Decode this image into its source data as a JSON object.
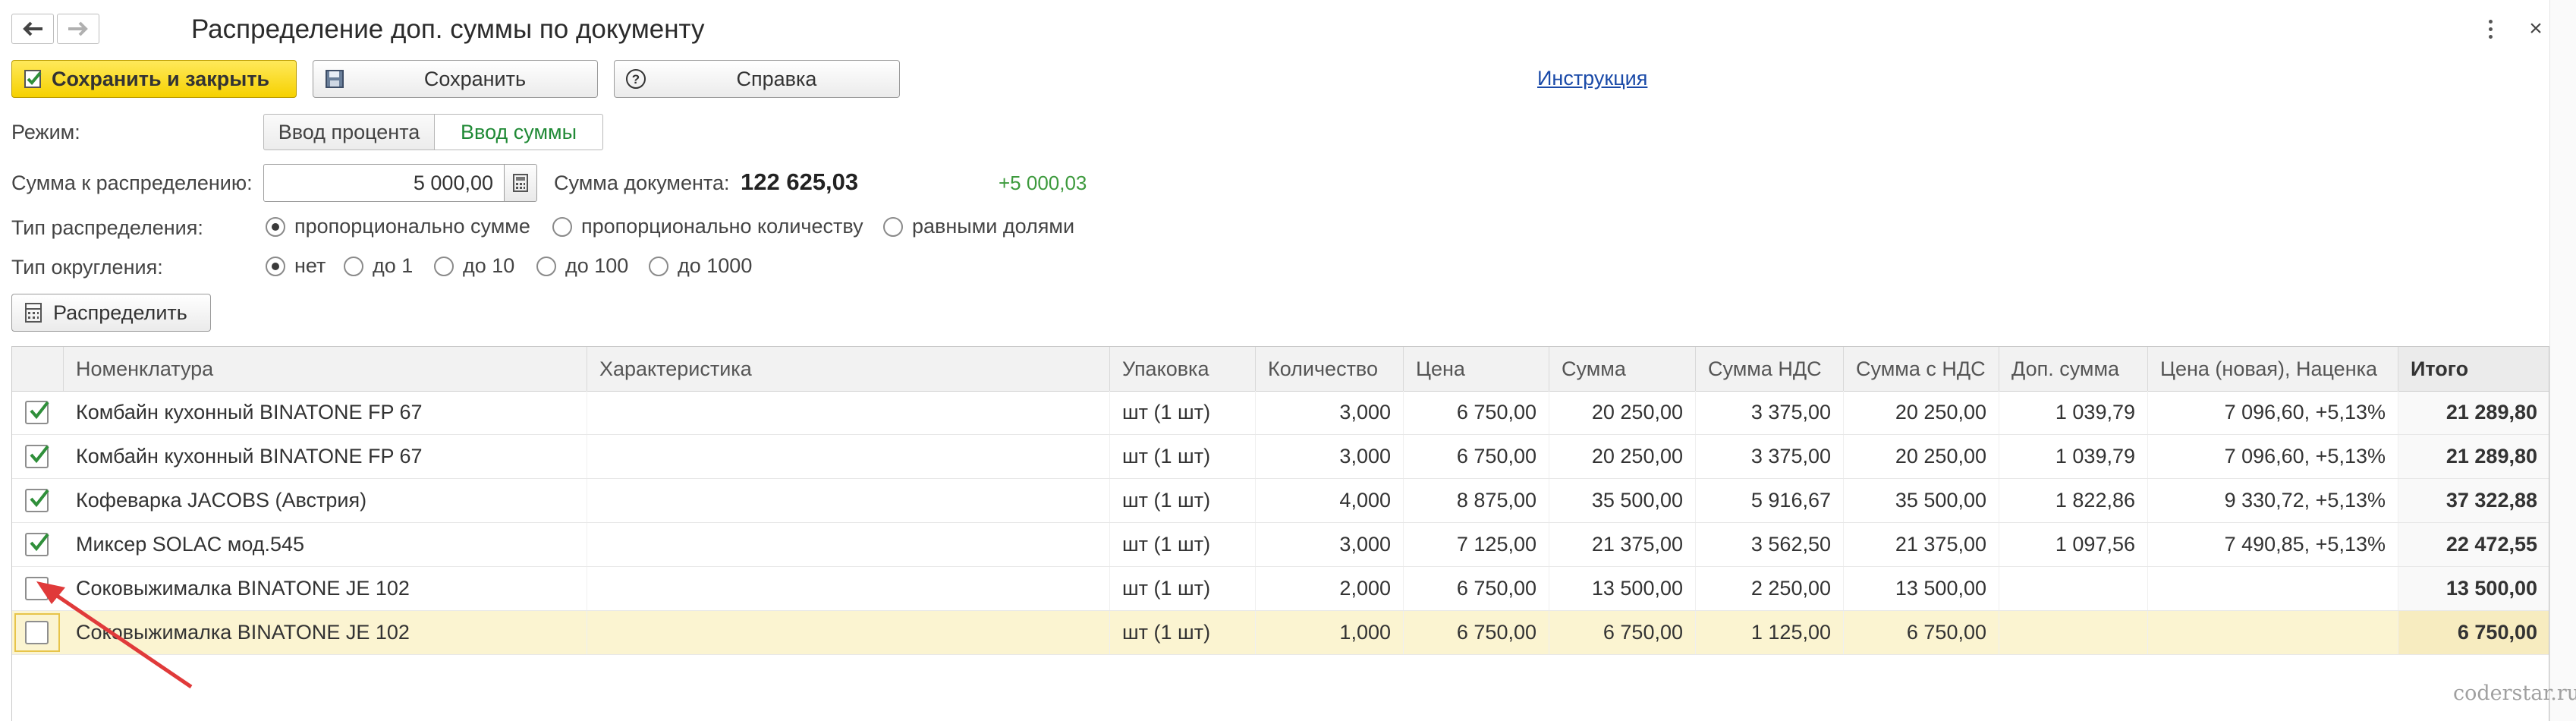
{
  "window": {
    "title": "Распределение доп. суммы по документу"
  },
  "toolbar": {
    "save_close": "Сохранить и закрыть",
    "save": "Сохранить",
    "help": "Справка",
    "instruction_link": "Инструкция"
  },
  "form": {
    "mode_label": "Режим:",
    "mode_options": [
      "Ввод процента",
      "Ввод суммы"
    ],
    "mode_selected": "Ввод суммы",
    "amount_label": "Сумма к распределению:",
    "amount_value": "5 000,00",
    "doc_sum_label": "Сумма документа:",
    "doc_sum_value": "122 625,03",
    "doc_sum_delta": "+5 000,03",
    "dist_type_label": "Тип распределения:",
    "dist_type_options": [
      "пропорционально сумме",
      "пропорционально количеству",
      "равными долями"
    ],
    "dist_type_selected": "пропорционально сумме",
    "rounding_label": "Тип округления:",
    "rounding_options": [
      "нет",
      "до 1",
      "до 10",
      "до 100",
      "до 1000"
    ],
    "rounding_selected": "нет",
    "distribute_button": "Распределить"
  },
  "table": {
    "columns": [
      "",
      "Номенклатура",
      "Характеристика",
      "Упаковка",
      "Количество",
      "Цена",
      "Сумма",
      "Сумма НДС",
      "Сумма с НДС",
      "Доп. сумма",
      "Цена (новая), Наценка",
      "Итого"
    ],
    "rows": [
      {
        "checked": true,
        "name": "Комбайн кухонный BINATONE FP 67",
        "char": "",
        "pack": "шт (1 шт)",
        "qty": "3,000",
        "price": "6 750,00",
        "sum": "20 250,00",
        "vat": "3 375,00",
        "sum_vat": "20 250,00",
        "extra": "1 039,79",
        "new_price": "7 096,60, +5,13%",
        "total": "21 289,80"
      },
      {
        "checked": true,
        "name": "Комбайн кухонный BINATONE FP 67",
        "char": "",
        "pack": "шт (1 шт)",
        "qty": "3,000",
        "price": "6 750,00",
        "sum": "20 250,00",
        "vat": "3 375,00",
        "sum_vat": "20 250,00",
        "extra": "1 039,79",
        "new_price": "7 096,60, +5,13%",
        "total": "21 289,80"
      },
      {
        "checked": true,
        "name": "Кофеварка JACOBS (Австрия)",
        "char": "",
        "pack": "шт (1 шт)",
        "qty": "4,000",
        "price": "8 875,00",
        "sum": "35 500,00",
        "vat": "5 916,67",
        "sum_vat": "35 500,00",
        "extra": "1 822,86",
        "new_price": "9 330,72, +5,13%",
        "total": "37 322,88"
      },
      {
        "checked": true,
        "name": "Миксер SOLAC мод.545",
        "char": "",
        "pack": "шт (1 шт)",
        "qty": "3,000",
        "price": "7 125,00",
        "sum": "21 375,00",
        "vat": "3 562,50",
        "sum_vat": "21 375,00",
        "extra": "1 097,56",
        "new_price": "7 490,85, +5,13%",
        "total": "22 472,55"
      },
      {
        "checked": false,
        "name": "Соковыжималка  BINATONE JE 102",
        "char": "",
        "pack": "шт (1 шт)",
        "qty": "2,000",
        "price": "6 750,00",
        "sum": "13 500,00",
        "vat": "2 250,00",
        "sum_vat": "13 500,00",
        "extra": "",
        "new_price": "",
        "total": "13 500,00"
      },
      {
        "checked": false,
        "name": "Соковыжималка  BINATONE JE 102",
        "char": "",
        "pack": "шт (1 шт)",
        "qty": "1,000",
        "price": "6 750,00",
        "sum": "6 750,00",
        "vat": "1 125,00",
        "sum_vat": "6 750,00",
        "extra": "",
        "new_price": "",
        "total": "6 750,00",
        "selected": true
      }
    ]
  },
  "watermark": "coderstar.ru",
  "colors": {
    "primary_button": "#f6d100",
    "mode_active": "#208a36",
    "link": "#1a4aa8",
    "selected_row": "#fbf4d1",
    "annotation_arrow": "#e03a3a",
    "checkmark": "#2f8f3a"
  }
}
